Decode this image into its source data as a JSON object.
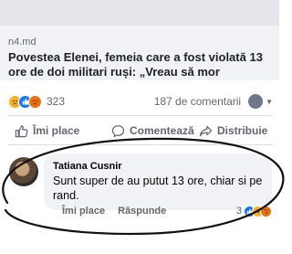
{
  "link_card": {
    "domain": "n4.md",
    "headline": "Povestea Elenei, femeia care a fost violată 13 ore de doi militari ruși: „Vreau să mor"
  },
  "reactions": {
    "count": "323",
    "icons": [
      "sad-emoji-icon",
      "like-icon",
      "angry-emoji-icon"
    ],
    "comments_count": "187 de comentarii"
  },
  "actions": {
    "like": "Îmi place",
    "comment": "Comentează",
    "share": "Distribuie"
  },
  "comment": {
    "author": "Tatiana Cusnir",
    "text": "Sunt super de au putut 13 ore, chiar si pe rand.",
    "like_label": "Îmi place",
    "reply_label": "Răspunde",
    "reaction_count": "3",
    "reaction_icons": [
      "like-icon",
      "haha-emoji-icon",
      "angry-emoji-icon"
    ]
  },
  "colors": {
    "annotation_ellipse": "#111111",
    "like_blue": "#1877f2",
    "muted_text": "#606770"
  }
}
